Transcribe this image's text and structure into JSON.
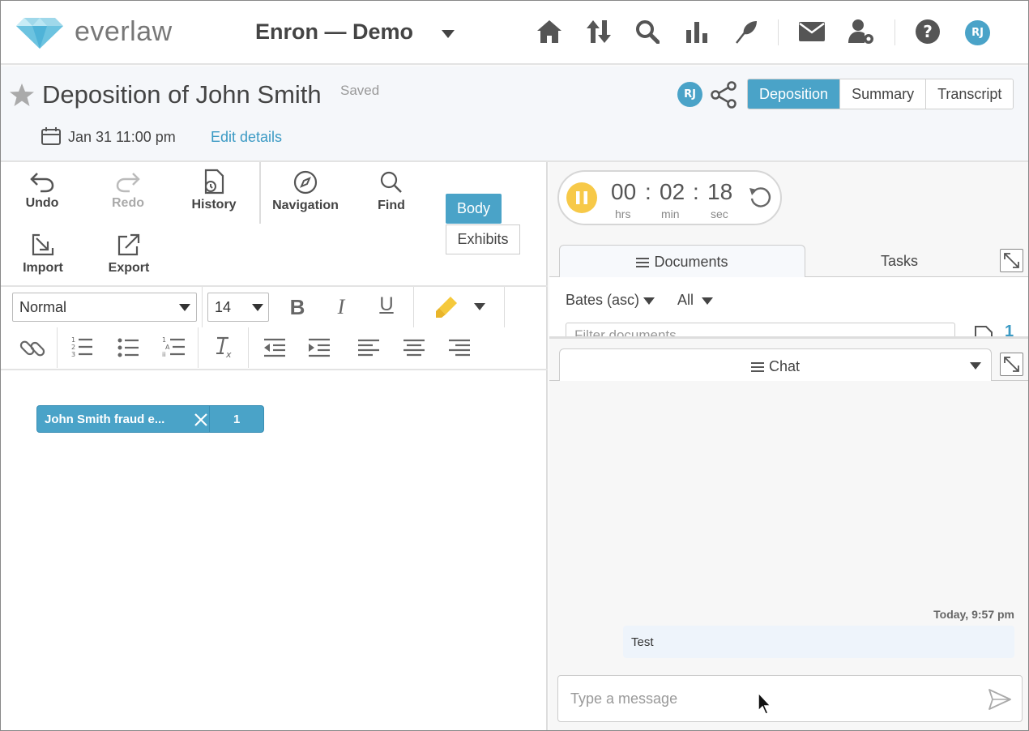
{
  "app": {
    "logo_text": "everlaw",
    "project_name": "Enron — Demo",
    "user_initials": "RJ"
  },
  "nav_icons": [
    "home-icon",
    "upload-download-icon",
    "search-icon",
    "bar-chart-icon",
    "feather-icon",
    "mail-icon",
    "user-settings-icon",
    "help-icon"
  ],
  "header": {
    "title": "Deposition of John Smith",
    "status": "Saved",
    "date": "Jan 31 11:00 pm",
    "edit_link": "Edit details",
    "owner_initials": "RJ",
    "tabs": [
      "Deposition",
      "Summary",
      "Transcript"
    ]
  },
  "toolbar": {
    "undo": "Undo",
    "redo": "Redo",
    "history": "History",
    "navigation": "Navigation",
    "find": "Find",
    "import": "Import",
    "export": "Export",
    "body_toggle": "Body",
    "exhibits_toggle": "Exhibits"
  },
  "format": {
    "style": "Normal",
    "size": "14",
    "bold": "B",
    "italic": "I",
    "underline": "U"
  },
  "editor": {
    "chip_label": "John Smith fraud e...",
    "chip_count": "1"
  },
  "timer": {
    "hrs": "00",
    "min": "02",
    "sec": "18",
    "hrs_label": "hrs",
    "min_label": "min",
    "sec_label": "sec",
    "sep": ":"
  },
  "docs_panel": {
    "tab_documents": "Documents",
    "tab_tasks": "Tasks",
    "sort": "Bates (asc)",
    "filter": "All",
    "filter_placeholder": "Filter documents",
    "count": "1"
  },
  "chat": {
    "tab": "Chat",
    "timestamp": "Today, 9:57 pm",
    "message": "Test",
    "input_placeholder": "Type a message"
  },
  "colors": {
    "accent": "#4aa3c8",
    "pause": "#f7c948"
  }
}
